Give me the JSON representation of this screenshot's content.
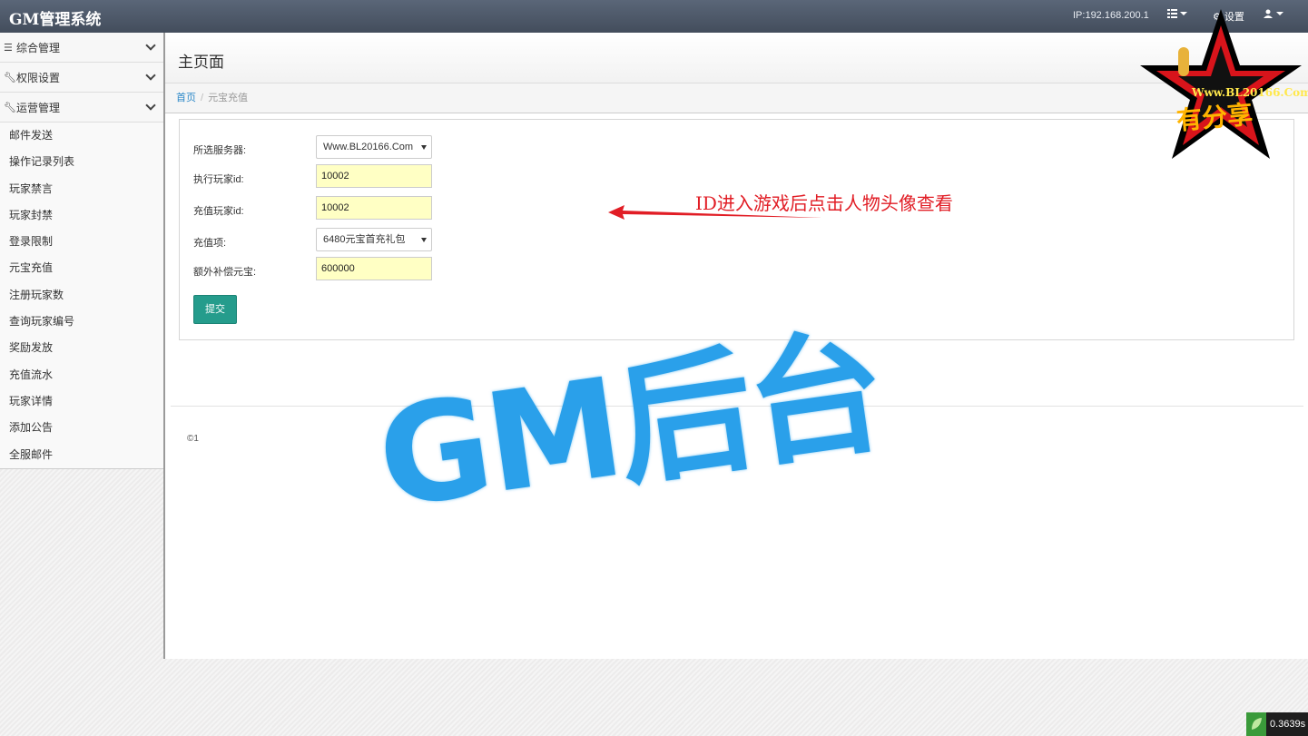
{
  "app": {
    "title": "GM管理系统"
  },
  "navbar": {
    "ip": "IP:192.168.200.1",
    "settings": "设置"
  },
  "sidebar": {
    "groups": [
      {
        "label": "综合管理"
      },
      {
        "label": "权限设置"
      },
      {
        "label": "运营管理"
      }
    ],
    "items": [
      "邮件发送",
      "操作记录列表",
      "玩家禁言",
      "玩家封禁",
      "登录限制",
      "元宝充值",
      "注册玩家数",
      "查询玩家编号",
      "奖励发放",
      "充值流水",
      "玩家详情",
      "添加公告",
      "全服邮件"
    ]
  },
  "page": {
    "title": "主页面"
  },
  "breadcrumb": {
    "home": "首页",
    "sep": "/",
    "current": "元宝充值"
  },
  "form": {
    "server": {
      "label": "所选服务器:",
      "value": "Www.BL20166.Com"
    },
    "exec_player": {
      "label": "执行玩家id:",
      "value": "10002"
    },
    "recharge_player": {
      "label": "充值玩家id:",
      "value": "10002"
    },
    "recharge_item": {
      "label": "充值项:",
      "value": "6480元宝首充礼包"
    },
    "extra_yuanbao": {
      "label": "额外补偿元宝:",
      "value": "600000"
    },
    "submit_label": "提交"
  },
  "annotation": {
    "hint": "ID进入游戏后点击人物头像查看"
  },
  "footer": {
    "copyright": "©1"
  },
  "watermark": {
    "big_text": "GM后台",
    "logo_url": "Www.BL20166.Com",
    "logo_text": "有分享"
  },
  "timer": {
    "value": "0.3639s"
  },
  "colors": {
    "navbar": "#4d5869",
    "submit": "#259c8c",
    "hint": "#e11d25",
    "watermark": "#2aa0ea",
    "input_bg": "#ffffc4"
  }
}
